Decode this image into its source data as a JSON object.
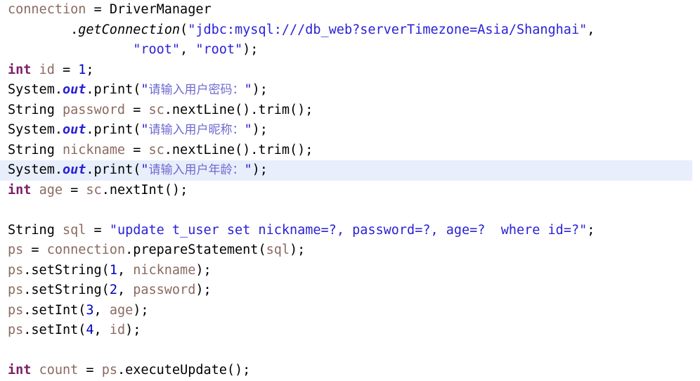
{
  "editor": {
    "language": "java",
    "background_color": "#ffffff",
    "highlight_color": "#e8eefb",
    "colors": {
      "keyword": "#7a1f63",
      "variable": "#8a6a60",
      "string": "#2a21d6",
      "cjk_string": "#6f6ad0",
      "static_field": "#2a21d6",
      "plain": "#000000"
    }
  },
  "code": {
    "lines": [
      {
        "index": 1,
        "highlighted": false,
        "tokens": [
          {
            "text": "connection",
            "type": "var"
          },
          {
            "text": " = ",
            "type": "plain"
          },
          {
            "text": "DriverManager",
            "type": "plain"
          }
        ]
      },
      {
        "index": 2,
        "highlighted": false,
        "tokens": [
          {
            "text": "        ",
            "type": "plain"
          },
          {
            "text": ".",
            "type": "plain"
          },
          {
            "text": "getConnection",
            "type": "method-static"
          },
          {
            "text": "(",
            "type": "plain"
          },
          {
            "text": "\"jdbc:mysql:///db_web?serverTimezone=Asia/Shanghai\"",
            "type": "string"
          },
          {
            "text": ",",
            "type": "plain"
          }
        ]
      },
      {
        "index": 3,
        "highlighted": false,
        "tokens": [
          {
            "text": "                ",
            "type": "plain"
          },
          {
            "text": "\"root\"",
            "type": "string"
          },
          {
            "text": ", ",
            "type": "plain"
          },
          {
            "text": "\"root\"",
            "type": "string"
          },
          {
            "text": ");",
            "type": "plain"
          }
        ]
      },
      {
        "index": 4,
        "highlighted": false,
        "tokens": [
          {
            "text": "int",
            "type": "keyword"
          },
          {
            "text": " ",
            "type": "plain"
          },
          {
            "text": "id",
            "type": "var"
          },
          {
            "text": " = ",
            "type": "plain"
          },
          {
            "text": "1",
            "type": "num"
          },
          {
            "text": ";",
            "type": "plain"
          }
        ]
      },
      {
        "index": 5,
        "highlighted": false,
        "tokens": [
          {
            "text": "System.",
            "type": "plain"
          },
          {
            "text": "out",
            "type": "field"
          },
          {
            "text": ".print(",
            "type": "plain"
          },
          {
            "text": "\"",
            "type": "string"
          },
          {
            "text": "请输入用户密码：",
            "type": "cjk"
          },
          {
            "text": "\"",
            "type": "string"
          },
          {
            "text": ");",
            "type": "plain"
          }
        ]
      },
      {
        "index": 6,
        "highlighted": false,
        "tokens": [
          {
            "text": "String ",
            "type": "plain"
          },
          {
            "text": "password",
            "type": "var"
          },
          {
            "text": " = ",
            "type": "plain"
          },
          {
            "text": "sc",
            "type": "var"
          },
          {
            "text": ".nextLine().trim();",
            "type": "plain"
          }
        ]
      },
      {
        "index": 7,
        "highlighted": false,
        "tokens": [
          {
            "text": "System.",
            "type": "plain"
          },
          {
            "text": "out",
            "type": "field"
          },
          {
            "text": ".print(",
            "type": "plain"
          },
          {
            "text": "\"",
            "type": "string"
          },
          {
            "text": "请输入用户昵称：",
            "type": "cjk"
          },
          {
            "text": "\"",
            "type": "string"
          },
          {
            "text": ");",
            "type": "plain"
          }
        ]
      },
      {
        "index": 8,
        "highlighted": false,
        "tokens": [
          {
            "text": "String ",
            "type": "plain"
          },
          {
            "text": "nickname",
            "type": "var"
          },
          {
            "text": " = ",
            "type": "plain"
          },
          {
            "text": "sc",
            "type": "var"
          },
          {
            "text": ".nextLine().trim();",
            "type": "plain"
          }
        ]
      },
      {
        "index": 9,
        "highlighted": true,
        "tokens": [
          {
            "text": "System.",
            "type": "plain"
          },
          {
            "text": "out",
            "type": "field"
          },
          {
            "text": ".print(",
            "type": "plain"
          },
          {
            "text": "\"",
            "type": "string"
          },
          {
            "text": "请输入用户年龄：",
            "type": "cjk"
          },
          {
            "text": "\"",
            "type": "string"
          },
          {
            "text": ");",
            "type": "plain"
          }
        ]
      },
      {
        "index": 10,
        "highlighted": false,
        "tokens": [
          {
            "text": "int",
            "type": "keyword"
          },
          {
            "text": " ",
            "type": "plain"
          },
          {
            "text": "age",
            "type": "var"
          },
          {
            "text": " = ",
            "type": "plain"
          },
          {
            "text": "sc",
            "type": "var"
          },
          {
            "text": ".nextInt();",
            "type": "plain"
          }
        ]
      },
      {
        "index": 11,
        "highlighted": false,
        "tokens": []
      },
      {
        "index": 12,
        "highlighted": false,
        "tokens": [
          {
            "text": "String ",
            "type": "plain"
          },
          {
            "text": "sql",
            "type": "var"
          },
          {
            "text": " = ",
            "type": "plain"
          },
          {
            "text": "\"update t_user set nickname=?, password=?, age=?  where id=?\"",
            "type": "string"
          },
          {
            "text": ";",
            "type": "plain"
          }
        ]
      },
      {
        "index": 13,
        "highlighted": false,
        "tokens": [
          {
            "text": "ps",
            "type": "var"
          },
          {
            "text": " = ",
            "type": "plain"
          },
          {
            "text": "connection",
            "type": "var"
          },
          {
            "text": ".prepareStatement(",
            "type": "plain"
          },
          {
            "text": "sql",
            "type": "var"
          },
          {
            "text": ");",
            "type": "plain"
          }
        ]
      },
      {
        "index": 14,
        "highlighted": false,
        "tokens": [
          {
            "text": "ps",
            "type": "var"
          },
          {
            "text": ".setString(",
            "type": "plain"
          },
          {
            "text": "1",
            "type": "num"
          },
          {
            "text": ", ",
            "type": "plain"
          },
          {
            "text": "nickname",
            "type": "var"
          },
          {
            "text": ");",
            "type": "plain"
          }
        ]
      },
      {
        "index": 15,
        "highlighted": false,
        "tokens": [
          {
            "text": "ps",
            "type": "var"
          },
          {
            "text": ".setString(",
            "type": "plain"
          },
          {
            "text": "2",
            "type": "num"
          },
          {
            "text": ", ",
            "type": "plain"
          },
          {
            "text": "password",
            "type": "var"
          },
          {
            "text": ");",
            "type": "plain"
          }
        ]
      },
      {
        "index": 16,
        "highlighted": false,
        "tokens": [
          {
            "text": "ps",
            "type": "var"
          },
          {
            "text": ".setInt(",
            "type": "plain"
          },
          {
            "text": "3",
            "type": "num"
          },
          {
            "text": ", ",
            "type": "plain"
          },
          {
            "text": "age",
            "type": "var"
          },
          {
            "text": ");",
            "type": "plain"
          }
        ]
      },
      {
        "index": 17,
        "highlighted": false,
        "tokens": [
          {
            "text": "ps",
            "type": "var"
          },
          {
            "text": ".setInt(",
            "type": "plain"
          },
          {
            "text": "4",
            "type": "num"
          },
          {
            "text": ", ",
            "type": "plain"
          },
          {
            "text": "id",
            "type": "var"
          },
          {
            "text": ");",
            "type": "plain"
          }
        ]
      },
      {
        "index": 18,
        "highlighted": false,
        "tokens": []
      },
      {
        "index": 19,
        "highlighted": false,
        "tokens": [
          {
            "text": "int",
            "type": "keyword"
          },
          {
            "text": " ",
            "type": "plain"
          },
          {
            "text": "count",
            "type": "var"
          },
          {
            "text": " = ",
            "type": "plain"
          },
          {
            "text": "ps",
            "type": "var"
          },
          {
            "text": ".executeUpdate();",
            "type": "plain"
          }
        ]
      }
    ]
  }
}
